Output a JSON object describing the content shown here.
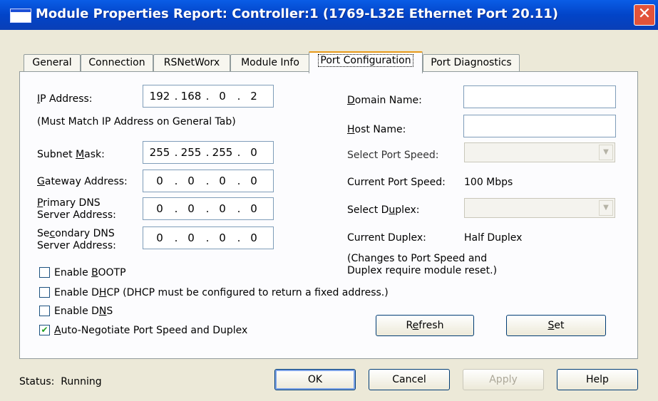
{
  "window": {
    "title": "Module Properties Report: Controller:1 (1769-L32E Ethernet Port 20.11)",
    "close_glyph": "✕"
  },
  "tabs": [
    {
      "label": "General"
    },
    {
      "label": "Connection"
    },
    {
      "label": "RSNetWorx"
    },
    {
      "label": "Module Info"
    },
    {
      "label": "Port Configuration",
      "active": true
    },
    {
      "label": "Port Diagnostics"
    }
  ],
  "left": {
    "ip_label_u": "I",
    "ip_label_rest": "P Address:",
    "ip": [
      "192",
      "168",
      "0",
      "2"
    ],
    "ip_note": "(Must Match IP Address on General Tab)",
    "subnet_label_pre": "Subnet ",
    "subnet_label_u": "M",
    "subnet_label_post": "ask:",
    "subnet": [
      "255",
      "255",
      "255",
      "0"
    ],
    "gateway_label_u": "G",
    "gateway_label_rest": "ateway Address:",
    "gateway": [
      "0",
      "0",
      "0",
      "0"
    ],
    "primary_dns_label_line1_u": "P",
    "primary_dns_label_line1_rest": "rimary DNS",
    "primary_dns_label_line2": "Server Address:",
    "primary_dns": [
      "0",
      "0",
      "0",
      "0"
    ],
    "secondary_dns_label_line1_pre": "Se",
    "secondary_dns_label_line1_u": "c",
    "secondary_dns_label_line1_post": "ondary DNS",
    "secondary_dns_label_line2": "Server Address:",
    "secondary_dns": [
      "0",
      "0",
      "0",
      "0"
    ]
  },
  "right": {
    "domain_label_u": "D",
    "domain_label_rest": "omain Name:",
    "domain_value": "",
    "host_label_u": "H",
    "host_label_rest": "ost Name:",
    "host_value": "",
    "select_speed_label": "Select Port Speed:",
    "current_speed_label": "Current Port Speed:",
    "current_speed_value": "100 Mbps",
    "select_duplex_label_pre": "Select D",
    "select_duplex_label_u": "u",
    "select_duplex_label_post": "plex:",
    "current_duplex_label": "Current Duplex:",
    "current_duplex_value": "Half Duplex",
    "note_line1": "(Changes to Port Speed and",
    "note_line2": "Duplex require module reset.)",
    "refresh_pre": "R",
    "refresh_u": "e",
    "refresh_post": "fresh",
    "set_u": "S",
    "set_rest": "et"
  },
  "checkboxes": [
    {
      "pre": "Enable ",
      "u": "B",
      "post": "OOTP",
      "checked": false
    },
    {
      "pre": "Enable D",
      "u": "H",
      "post": "CP  (DHCP must be configured to return a fixed address.)",
      "checked": false
    },
    {
      "pre": "Enable D",
      "u": "N",
      "post": "S",
      "checked": false
    },
    {
      "pre": "",
      "u": "A",
      "post": "uto-Negotiate Port Speed and Duplex",
      "checked": true
    }
  ],
  "check_glyph": "✔",
  "combo_arrow_glyph": "▼",
  "footer": {
    "status_label": "Status:",
    "status_value": "Running",
    "ok": "OK",
    "cancel": "Cancel",
    "apply": "Apply",
    "help": "Help"
  }
}
